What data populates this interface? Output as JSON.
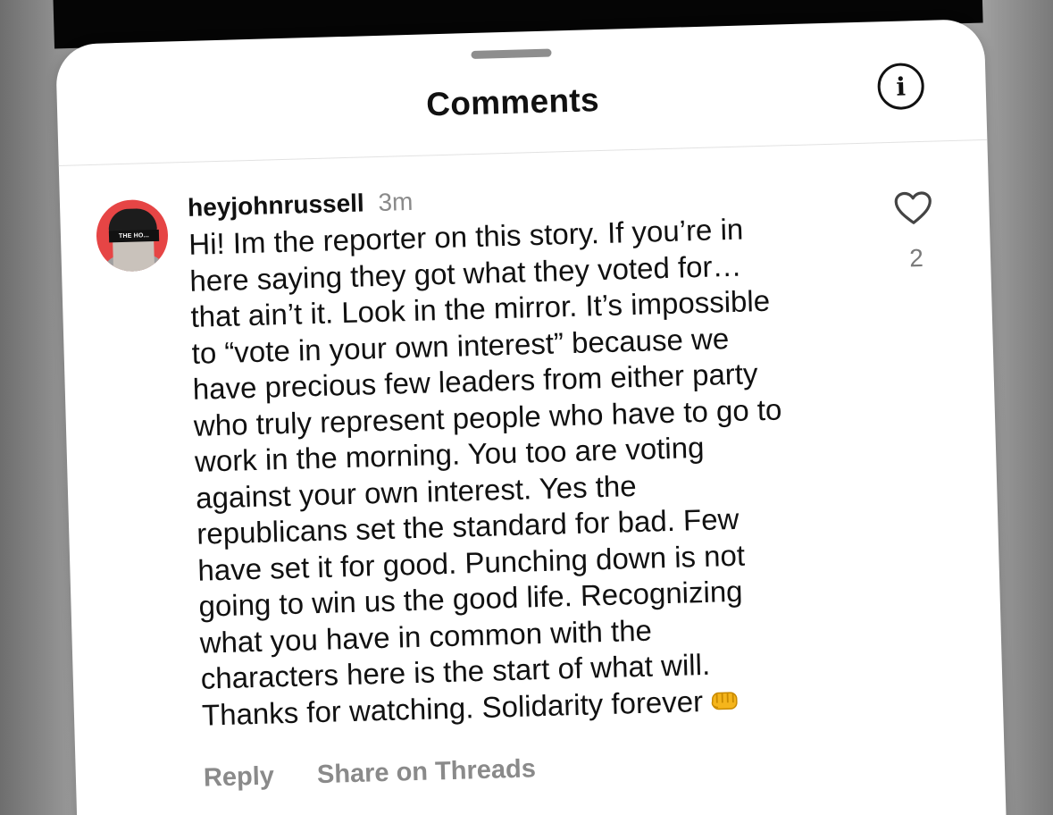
{
  "sheet": {
    "title": "Comments"
  },
  "comment": {
    "username": "heyjohnrussell",
    "timestamp": "3m",
    "avatar_badge": "THE HO... ",
    "text": "Hi! Im the reporter on this story. If you’re in\nhere saying they got what they voted for…\nthat ain’t it. Look in the mirror. It’s impossible\nto “vote in your own interest” because we\nhave precious few leaders from either party\nwho truly represent people who have to go to\nwork in the morning. You too are voting\nagainst your own interest. Yes the\nrepublicans set the standard for bad. Few\nhave set it for good. Punching down is not\ngoing to win us the good life. Recognizing\nwhat you have in common with the\ncharacters here is the start of what will.\nThanks for watching. Solidarity forever",
    "emoji": "fist-emoji",
    "like_count": "2",
    "reply_label": "Reply",
    "share_label": "Share on Threads"
  },
  "icons": {
    "info": "info-icon",
    "like": "heart-icon"
  },
  "colors": {
    "sheet": "#ffffff",
    "text": "#111111",
    "muted": "#8a8a8a",
    "avatar_bg": "#e64545"
  }
}
